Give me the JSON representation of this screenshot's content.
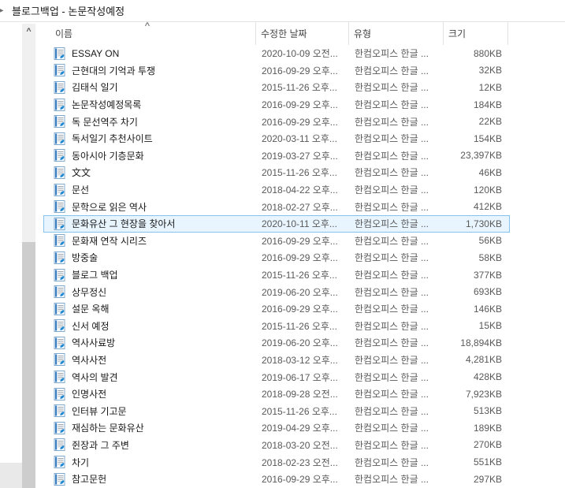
{
  "window": {
    "title": "블로그백업 - 논문작성예정"
  },
  "icons": {
    "breadcrumb_arrow": "▸",
    "scrollbar_up_arrow": "∧",
    "sort_ascending": "∧",
    "file_icon_type": "hwp-document-icon"
  },
  "colors": {
    "selection_background": "#e9f5fe",
    "selection_border": "#84c3ee",
    "icon_blue": "#1e88d2",
    "scrollbar_track": "#f0f0f0",
    "scrollbar_thumb": "#cdcdcd"
  },
  "columns": {
    "name": "이름",
    "date": "수정한 날짜",
    "type": "유형",
    "size": "크기"
  },
  "files": [
    {
      "name": "ESSAY ON",
      "date": "2020-10-09 오전...",
      "type": "한컴오피스 한글 ...",
      "size": "880KB",
      "selected": false
    },
    {
      "name": "근현대의 기억과 투쟁",
      "date": "2016-09-29 오후...",
      "type": "한컴오피스 한글 ...",
      "size": "32KB",
      "selected": false
    },
    {
      "name": "김태식 일기",
      "date": "2015-11-26 오후...",
      "type": "한컴오피스 한글 ...",
      "size": "12KB",
      "selected": false
    },
    {
      "name": "논문작성예정목록",
      "date": "2016-09-29 오후...",
      "type": "한컴오피스 한글 ...",
      "size": "184KB",
      "selected": false
    },
    {
      "name": "독 문선역주 차기",
      "date": "2016-09-29 오후...",
      "type": "한컴오피스 한글 ...",
      "size": "22KB",
      "selected": false
    },
    {
      "name": "독서일기 추천사이트",
      "date": "2020-03-11 오후...",
      "type": "한컴오피스 한글 ...",
      "size": "154KB",
      "selected": false
    },
    {
      "name": "동아시아 기층문화",
      "date": "2019-03-27 오후...",
      "type": "한컴오피스 한글 ...",
      "size": "23,397KB",
      "selected": false
    },
    {
      "name": "文文",
      "date": "2015-11-26 오후...",
      "type": "한컴오피스 한글 ...",
      "size": "46KB",
      "selected": false
    },
    {
      "name": "문선",
      "date": "2018-04-22 오후...",
      "type": "한컴오피스 한글 ...",
      "size": "120KB",
      "selected": false
    },
    {
      "name": "문학으로 읽은 역사",
      "date": "2018-02-27 오후...",
      "type": "한컴오피스 한글 ...",
      "size": "412KB",
      "selected": false
    },
    {
      "name": "문화유산 그 현장을 찾아서",
      "date": "2020-10-11 오후...",
      "type": "한컴오피스 한글 ...",
      "size": "1,730KB",
      "selected": true
    },
    {
      "name": "문화재 연작 시리즈",
      "date": "2016-09-29 오후...",
      "type": "한컴오피스 한글 ...",
      "size": "56KB",
      "selected": false
    },
    {
      "name": "방중술",
      "date": "2016-09-29 오후...",
      "type": "한컴오피스 한글 ...",
      "size": "58KB",
      "selected": false
    },
    {
      "name": "블로그 백업",
      "date": "2015-11-26 오후...",
      "type": "한컴오피스 한글 ...",
      "size": "377KB",
      "selected": false
    },
    {
      "name": "상무정신",
      "date": "2019-06-20 오후...",
      "type": "한컴오피스 한글 ...",
      "size": "693KB",
      "selected": false
    },
    {
      "name": "설문 옥해",
      "date": "2016-09-29 오후...",
      "type": "한컴오피스 한글 ...",
      "size": "146KB",
      "selected": false
    },
    {
      "name": "신서 예정",
      "date": "2015-11-26 오후...",
      "type": "한컴오피스 한글 ...",
      "size": "15KB",
      "selected": false
    },
    {
      "name": "역사사료방",
      "date": "2019-06-20 오후...",
      "type": "한컴오피스 한글 ...",
      "size": "18,894KB",
      "selected": false
    },
    {
      "name": "역사사전",
      "date": "2018-03-12 오후...",
      "type": "한컴오피스 한글 ...",
      "size": "4,281KB",
      "selected": false
    },
    {
      "name": "역사의 발견",
      "date": "2019-06-17 오후...",
      "type": "한컴오피스 한글 ...",
      "size": "428KB",
      "selected": false
    },
    {
      "name": "인명사전",
      "date": "2018-09-28 오전...",
      "type": "한컴오피스 한글 ...",
      "size": "7,923KB",
      "selected": false
    },
    {
      "name": "인터뷰 기고문",
      "date": "2015-11-26 오후...",
      "type": "한컴오피스 한글 ...",
      "size": "513KB",
      "selected": false
    },
    {
      "name": "재심하는 문화유산",
      "date": "2019-04-29 오후...",
      "type": "한컴오피스 한글 ...",
      "size": "189KB",
      "selected": false
    },
    {
      "name": "쥔장과 그 주변",
      "date": "2018-03-20 오전...",
      "type": "한컴오피스 한글 ...",
      "size": "270KB",
      "selected": false
    },
    {
      "name": "차기",
      "date": "2018-02-23 오전...",
      "type": "한컴오피스 한글 ...",
      "size": "551KB",
      "selected": false
    },
    {
      "name": "참고문헌",
      "date": "2016-09-29 오후...",
      "type": "한컴오피스 한글 ...",
      "size": "297KB",
      "selected": false
    }
  ]
}
